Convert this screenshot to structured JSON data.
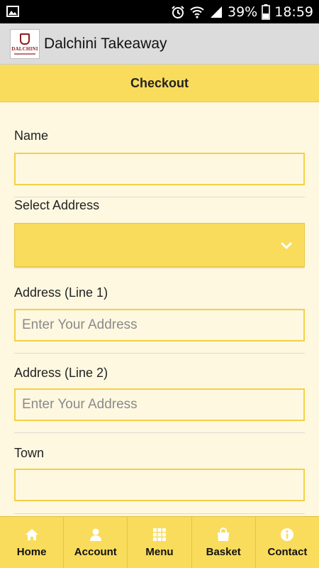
{
  "status_bar": {
    "battery_percent": "39%",
    "time": "18:59"
  },
  "app_bar": {
    "logo_text": "DALCHINI",
    "title": "Dalchini Takeaway"
  },
  "page": {
    "title": "Checkout"
  },
  "form": {
    "name": {
      "label": "Name",
      "value": "",
      "placeholder": ""
    },
    "select_address": {
      "label": "Select Address",
      "value": ""
    },
    "address_line1": {
      "label": "Address (Line 1)",
      "value": "",
      "placeholder": "Enter Your Address"
    },
    "address_line2": {
      "label": "Address (Line 2)",
      "value": "",
      "placeholder": "Enter Your Address"
    },
    "town": {
      "label": "Town",
      "value": "",
      "placeholder": ""
    }
  },
  "bottom_nav": {
    "items": [
      {
        "label": "Home",
        "icon": "home-icon"
      },
      {
        "label": "Account",
        "icon": "user-icon"
      },
      {
        "label": "Menu",
        "icon": "grid-icon"
      },
      {
        "label": "Basket",
        "icon": "bag-icon"
      },
      {
        "label": "Contact",
        "icon": "info-icon"
      }
    ]
  },
  "colors": {
    "accent": "#f9dc5c",
    "background": "#fef8e1",
    "input_border": "#f4d046"
  }
}
